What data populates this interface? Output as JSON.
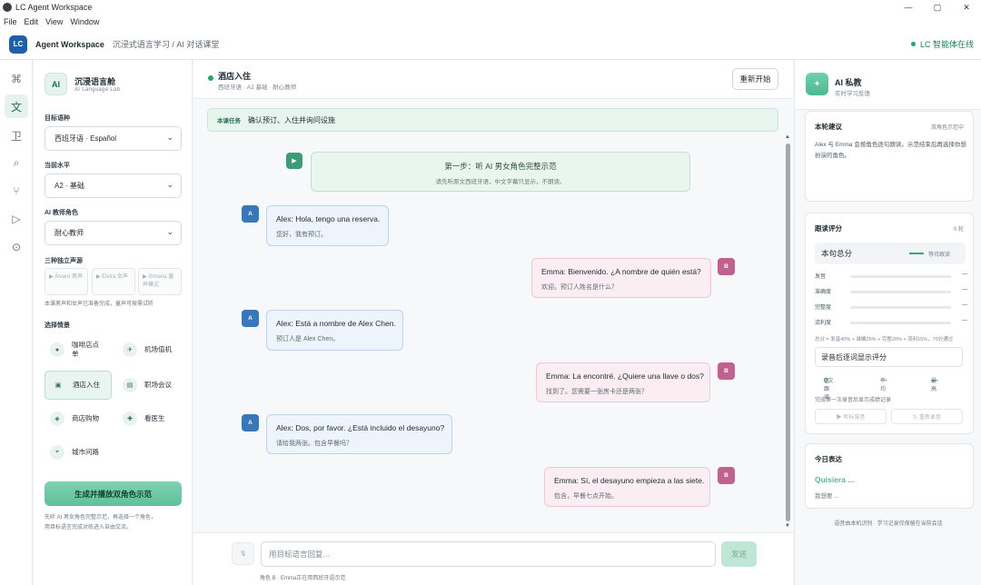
{
  "window": {
    "title": "LC Agent Workspace",
    "controls": [
      "—",
      "▢",
      "✕"
    ]
  },
  "menu": [
    "File",
    "Edit",
    "View",
    "Window"
  ],
  "appbar": {
    "logo": "LC",
    "name": "Agent Workspace",
    "breadcrumb": "沉浸式语言学习 / AI 对话课堂",
    "status": "LC 智能体在线",
    "status_color": "#27a36d"
  },
  "rail": [
    {
      "icon": "⌘",
      "name": "command-icon"
    },
    {
      "icon": "文",
      "name": "language-icon",
      "active": true
    },
    {
      "icon": "卫",
      "name": "shield-icon"
    },
    {
      "icon": "⌕",
      "name": "search-icon"
    },
    {
      "icon": "⑂",
      "name": "branch-icon"
    },
    {
      "icon": "▷",
      "name": "play-icon"
    },
    {
      "icon": "⊙",
      "name": "settings-icon"
    }
  ],
  "left": {
    "brand_icon": "AI",
    "brand_title": "沉浸语言舱",
    "brand_subtitle": "AI Language Lab",
    "target_label": "目标语种",
    "target_value": "西班牙语 · Español",
    "level_label": "当前水平",
    "level_value": "A2 · 基础",
    "teacher_label": "AI 教师角色",
    "teacher_value": "耐心教师",
    "voice_label": "三种独立声源",
    "voices": [
      "▶ Álvaro 男声",
      "▶ Elvira 女声",
      "▶ Ximena 童声模式"
    ],
    "voice_note": "本课男声和女声已准备完成，童声可按需试听",
    "scene_label": "选择情景",
    "scenes": [
      {
        "icon": "●",
        "label": "咖啡店点单"
      },
      {
        "icon": "✈",
        "label": "机场值机"
      },
      {
        "icon": "▣",
        "label": "酒店入住",
        "active": true
      },
      {
        "icon": "▤",
        "label": "职场会议"
      },
      {
        "icon": "◈",
        "label": "商店购物"
      },
      {
        "icon": "✚",
        "label": "看医生"
      },
      {
        "icon": "⌖",
        "label": "城市问路"
      }
    ],
    "generate_button": "生成并播放双角色示范",
    "generate_note_1": "先听 AI 男女角色完整示范，再选择一个角色，",
    "generate_note_2": "用目标语言完成对练进入自由交流。"
  },
  "chat": {
    "title": "酒店入住",
    "subtitle": "西班牙语 · A2 基础 · 耐心教师",
    "restart": "重新开始",
    "task_tag": "本课任务",
    "task_text": "确认预订、入住并询问设施",
    "step_icon": "▶",
    "step_title": "第一步：听 AI 男女角色完整示范",
    "step_desc": "请先听原文西班牙语，中文字幕只显示，不朗读。",
    "messages": [
      {
        "role": "A",
        "es": "Alex: Hola, tengo una reserva.",
        "zh": "您好，我有预订。"
      },
      {
        "role": "B",
        "es": "Emma: Bienvenido. ¿A nombre de quién está?",
        "zh": "欢迎。预订人姓名是什么？"
      },
      {
        "role": "A",
        "es": "Alex: Está a nombre de Alex Chen.",
        "zh": "预订人是 Alex Chen。"
      },
      {
        "role": "B",
        "es": "Emma: La encontré. ¿Quiere una llave o dos?",
        "zh": "找到了。您需要一张房卡还是两张？"
      },
      {
        "role": "A",
        "es": "Alex: Dos, por favor. ¿Está incluido el desayuno?",
        "zh": "请给我两张。包含早餐吗？"
      },
      {
        "role": "B",
        "es": "Emma: Sí, el desayuno empieza a las siete.",
        "zh": "包含，早餐七点开始。"
      }
    ],
    "mic": "🎙",
    "input_placeholder": "用目标语言回复...",
    "send": "发送",
    "input_hint": "角色 B · Emma正在用西班牙语示范"
  },
  "right": {
    "icon": "✦",
    "title": "AI 私教",
    "subtitle": "实时学习反馈",
    "suggest_title": "本轮建议",
    "suggest_meta": "双角色示范中",
    "suggest_text": "Alex 与 Emma 会按角色逐句朗读。示范结束后再选择你想扮演的角色。",
    "score_title": "跟读评分",
    "score_meta": "0 轮",
    "score_label": "本句总分",
    "score_wait": "等待跟读",
    "metrics": [
      {
        "label": "发音",
        "value": "—"
      },
      {
        "label": "准确度",
        "value": "—"
      },
      {
        "label": "完整度",
        "value": "—"
      },
      {
        "label": "流利度",
        "value": "—"
      }
    ],
    "formula": "总分 = 发音40% + 准确25% + 完整20% + 流利15%，70分通过",
    "record_text": "录音后逐词显示评分",
    "stats": {
      "practiced_label": "已跟读",
      "practiced_value": "0",
      "practiced_unit": "次",
      "avg_label": "平均",
      "avg_value": "—",
      "best_label": "最高",
      "best_value": "—"
    },
    "record_note": "完成第一次录音后显示成绩记录",
    "listen_button": "▶ 听标准音",
    "rerecord_button": "↻ 重新录音",
    "express_title": "今日表达",
    "express_phrase": "Quisiera ...",
    "express_meaning": "我想要 ...",
    "footer": "语音由本机识别 · 学习记录仅保留在当前会话"
  }
}
